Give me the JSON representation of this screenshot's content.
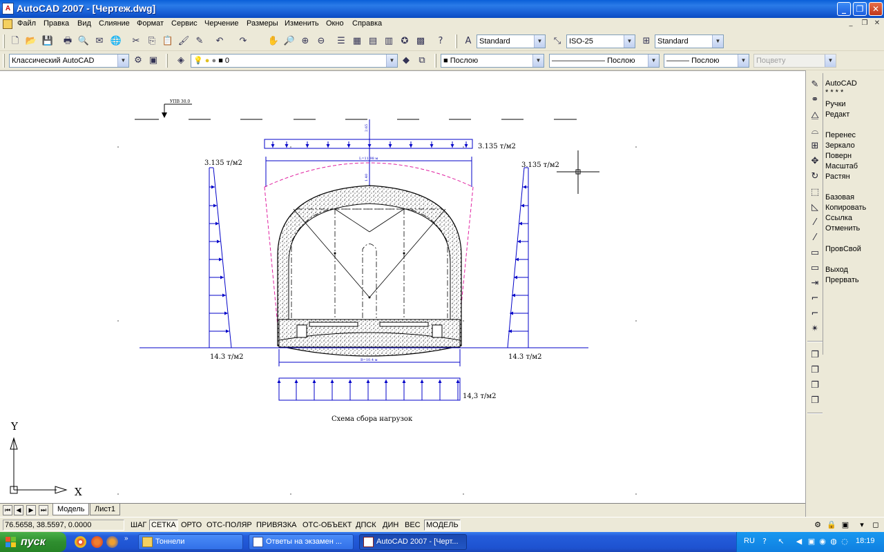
{
  "window": {
    "title": "AutoCAD 2007 - [Чертеж.dwg]",
    "app_icon": "A",
    "min": "_",
    "max": "❐",
    "close": "✕"
  },
  "menu": [
    "Файл",
    "Правка",
    "Вид",
    "Слияние",
    "Формат",
    "Сервис",
    "Черчение",
    "Размеры",
    "Изменить",
    "Окно",
    "Справка"
  ],
  "mdi": {
    "min": "_",
    "restore": "❐",
    "close": "✕"
  },
  "toolbar1": {
    "text_style": "Standard",
    "dim_style": "ISO-25",
    "table_style": "Standard"
  },
  "toolbar2": {
    "workspace": "Классический AutoCAD",
    "layer": "0",
    "color": "Послою",
    "linetype": "Послою",
    "lineweight": "Послою",
    "plotstyle": "Поцвету"
  },
  "drawing": {
    "top_mark": "УПВ 30.0",
    "load_top": "3.135 т/м2",
    "load_left_top": "3.135 т/м2",
    "load_right_top": "3.135 т/м2",
    "load_left_bottom": "14.3 т/м2",
    "load_right_bottom": "14.3 т/м2",
    "load_bottom": "14,3 т/м2",
    "dim_top": "L=11.98 м",
    "dim_bottom": "B=10.4 м",
    "dim_vert1": "2.65",
    "dim_vert2": "1.40",
    "caption": "Схема сбора нагрузок",
    "ucs_x": "X",
    "ucs_y": "Y"
  },
  "right_panel": {
    "items": [
      {
        "label": "AutoCAD",
        "icon": "pencil-icon"
      },
      {
        "label": "* * * *",
        "icon": ""
      },
      {
        "label": "Ручки",
        "icon": "grips-icon"
      },
      {
        "label": " Редакт",
        "icon": "mirror-icon"
      },
      {
        "label": "Перенес",
        "icon": "move-icon"
      },
      {
        "label": "Зеркало",
        "icon": "array-icon"
      },
      {
        "label": "Поверн",
        "icon": "move-cross-icon"
      },
      {
        "label": "Масштаб",
        "icon": "rotate-icon"
      },
      {
        "label": "Растян",
        "icon": ""
      },
      {
        "label": "Базовая",
        "icon": "scale-icon"
      },
      {
        "label": "Копировать",
        "icon": "stretch-icon"
      },
      {
        "label": "Ссылка",
        "icon": "trim-icon"
      },
      {
        "label": "Отменить",
        "icon": "extend-icon"
      },
      {
        "label": "ПровСвой",
        "icon": "break-icon"
      },
      {
        "label": "Выход",
        "icon": "join-icon"
      },
      {
        "label": "Прервать",
        "icon": "chamfer-icon"
      }
    ]
  },
  "tabs": [
    "Модель",
    "Лист1"
  ],
  "status": {
    "coords": "76.5658, 38.5597, 0.0000",
    "buttons": [
      "ШАГ",
      "СЕТКА",
      "ОРТО",
      "ОТС-ПОЛЯР",
      "ПРИВЯЗКА",
      "ОТС-ОБЪЕКТ",
      "ДПСК",
      "ДИН",
      "ВЕС",
      "МОДЕЛЬ"
    ],
    "on": [
      false,
      true,
      false,
      false,
      false,
      false,
      false,
      false,
      false,
      true
    ]
  },
  "taskbar": {
    "start": "пуск",
    "windows": [
      "Тоннели",
      "Ответы на экзамен ...",
      "AutoCAD 2007 - [Черт..."
    ],
    "lang": "RU",
    "clock": "18:19"
  },
  "colors": {
    "title_bar": "#0a5fd8",
    "drawing_blue": "#0000c8",
    "drawing_magenta": "#e020a0"
  }
}
